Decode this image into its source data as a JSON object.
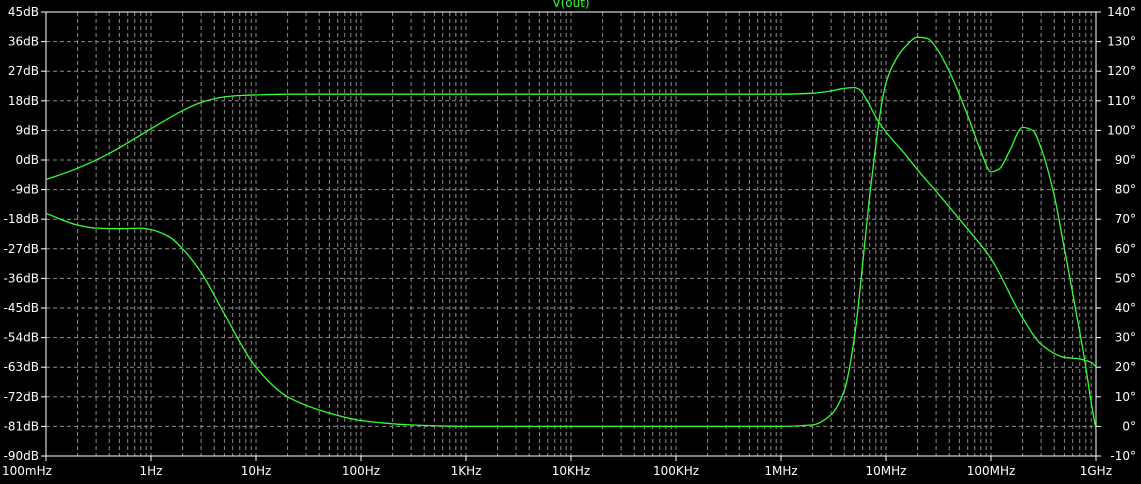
{
  "chart_data": {
    "type": "line",
    "title": "V(out)",
    "x_scale": "log",
    "xlim": [
      0.1,
      1000000000
    ],
    "x_ticks": [
      {
        "value": 0.1,
        "label": "100mHz"
      },
      {
        "value": 1,
        "label": "1Hz"
      },
      {
        "value": 10,
        "label": "10Hz"
      },
      {
        "value": 100,
        "label": "100Hz"
      },
      {
        "value": 1000,
        "label": "1KHz"
      },
      {
        "value": 10000,
        "label": "10KHz"
      },
      {
        "value": 100000,
        "label": "100KHz"
      },
      {
        "value": 1000000,
        "label": "1MHz"
      },
      {
        "value": 10000000,
        "label": "10MHz"
      },
      {
        "value": 100000000,
        "label": "100MHz"
      },
      {
        "value": 1000000000,
        "label": "1GHz"
      }
    ],
    "y_left": {
      "ylim": [
        -90,
        45
      ],
      "ticks": [
        {
          "value": 45,
          "label": "45dB"
        },
        {
          "value": 36,
          "label": "36dB"
        },
        {
          "value": 27,
          "label": "27dB"
        },
        {
          "value": 18,
          "label": "18dB"
        },
        {
          "value": 9,
          "label": "9dB"
        },
        {
          "value": 0,
          "label": "0dB"
        },
        {
          "value": -9,
          "label": "-9dB"
        },
        {
          "value": -18,
          "label": "-18dB"
        },
        {
          "value": -27,
          "label": "-27dB"
        },
        {
          "value": -36,
          "label": "-36dB"
        },
        {
          "value": -45,
          "label": "-45dB"
        },
        {
          "value": -54,
          "label": "-54dB"
        },
        {
          "value": -63,
          "label": "-63dB"
        },
        {
          "value": -72,
          "label": "-72dB"
        },
        {
          "value": -81,
          "label": "-81dB"
        },
        {
          "value": -90,
          "label": "-90dB"
        }
      ]
    },
    "y_right": {
      "ylim": [
        -10,
        140
      ],
      "ticks": [
        {
          "value": 140,
          "label": "140°"
        },
        {
          "value": 130,
          "label": "130°"
        },
        {
          "value": 120,
          "label": "120°"
        },
        {
          "value": 110,
          "label": "110°"
        },
        {
          "value": 100,
          "label": "100°"
        },
        {
          "value": 90,
          "label": "90°"
        },
        {
          "value": 80,
          "label": "80°"
        },
        {
          "value": 70,
          "label": "70°"
        },
        {
          "value": 60,
          "label": "60°"
        },
        {
          "value": 50,
          "label": "50°"
        },
        {
          "value": 40,
          "label": "40°"
        },
        {
          "value": 30,
          "label": "30°"
        },
        {
          "value": 20,
          "label": "20°"
        },
        {
          "value": 10,
          "label": "10°"
        },
        {
          "value": 0,
          "label": "0°"
        },
        {
          "value": -10,
          "label": "-10°"
        }
      ]
    },
    "grid": true,
    "colors": {
      "background": "#000000",
      "trace": "#33ff33",
      "grid": "#8c8c8c",
      "axis": "#ffffff",
      "label": "#ffffff"
    },
    "series": [
      {
        "axis": "left",
        "unit": "dB",
        "x": [
          0.1,
          0.2,
          0.4,
          0.7,
          1,
          2,
          3,
          5,
          7,
          10,
          20,
          100,
          1000,
          100000,
          1000000,
          2000000,
          3000000,
          4000000,
          5000000,
          5500000,
          6500000,
          8000000,
          10000000,
          15000000,
          20000000,
          30000000,
          50000000,
          100000000,
          200000000,
          300000000,
          500000000,
          700000000,
          800000000,
          900000000,
          1000000000
        ],
        "y": [
          -6,
          -2.5,
          2,
          6.5,
          9.5,
          15,
          17.5,
          19.2,
          19.6,
          19.8,
          20,
          20,
          20,
          20,
          20,
          20.3,
          21,
          21.8,
          22,
          21.6,
          18.5,
          13,
          8.5,
          2,
          -3,
          -9.5,
          -18,
          -30,
          -48,
          -56,
          -60,
          -60.5,
          -61,
          -61.5,
          -63
        ]
      },
      {
        "axis": "right",
        "unit": "°",
        "x": [
          0.1,
          0.2,
          0.3,
          0.5,
          0.8,
          1,
          1.5,
          2,
          3,
          5,
          10,
          20,
          50,
          100,
          300,
          1000,
          10000,
          100000,
          1000000,
          2000000,
          3000000,
          4000000,
          5000000,
          6000000,
          7000000,
          8000000,
          9000000,
          10000000,
          12000000,
          15000000,
          20000000,
          25000000,
          30000000,
          40000000,
          60000000,
          80000000,
          100000000,
          120000000,
          150000000,
          200000000,
          250000000,
          300000000,
          400000000,
          500000000,
          600000000,
          700000000,
          800000000,
          900000000,
          1000000000
        ],
        "y": [
          72,
          68,
          67,
          66.8,
          67,
          66.5,
          64,
          60,
          52,
          38,
          20,
          10,
          4.5,
          2,
          0.5,
          0,
          0,
          0,
          0,
          0.5,
          4,
          12,
          30,
          55,
          78,
          95,
          108,
          116,
          123,
          128,
          131.5,
          131,
          128,
          120,
          105,
          93,
          86,
          87,
          93,
          101,
          100,
          94,
          78,
          60,
          45,
          32,
          20,
          8,
          -1
        ]
      }
    ]
  }
}
